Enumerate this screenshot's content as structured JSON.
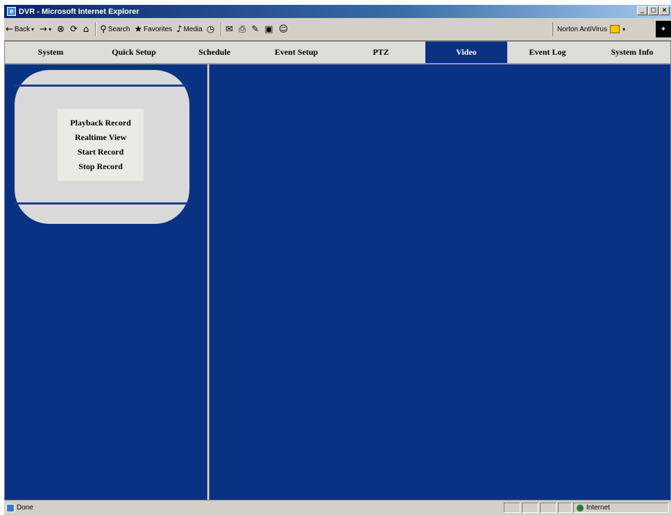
{
  "window": {
    "title": "DVR - Microsoft Internet Explorer",
    "controls": [
      "_",
      "□",
      "×"
    ]
  },
  "toolbar": {
    "back_label": "Back",
    "search_label": "Search",
    "favorites_label": "Favorites",
    "media_label": "Media",
    "norton_label": "Norton AntiVirus",
    "icons": [
      "back-arrow-icon",
      "forward-arrow-icon",
      "stop-icon",
      "refresh-icon",
      "home-icon",
      "search-icon",
      "favorites-icon",
      "media-icon",
      "history-icon",
      "mail-icon",
      "print-icon",
      "edit-icon",
      "discuss-icon",
      "messenger-icon"
    ]
  },
  "nav": {
    "items": [
      {
        "label": "System"
      },
      {
        "label": "Quick Setup"
      },
      {
        "label": "Schedule"
      },
      {
        "label": "Event Setup"
      },
      {
        "label": "PTZ"
      },
      {
        "label": "Video"
      },
      {
        "label": "Event Log"
      },
      {
        "label": "System Info"
      }
    ],
    "active": "Video",
    "active_color": "#0a3282"
  },
  "sidebar": {
    "menu": [
      {
        "label": "Playback Record"
      },
      {
        "label": "Realtime View"
      },
      {
        "label": "Start Record"
      },
      {
        "label": "Stop Record"
      }
    ]
  },
  "statusbar": {
    "status_text": "Done",
    "zone_text": "Internet"
  },
  "colors": {
    "page_background": "#0a3282",
    "nav_background": "#dcdcd8",
    "menu_panel": "#d9d9d9"
  }
}
